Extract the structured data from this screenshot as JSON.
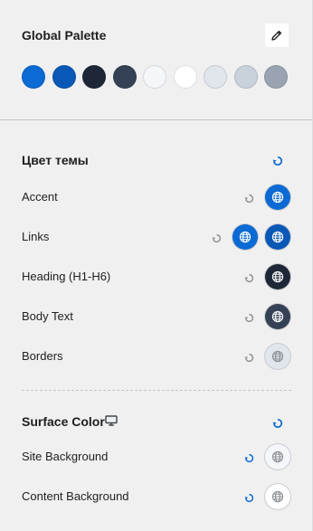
{
  "palette": {
    "title": "Global Palette",
    "colors": [
      "#0b6ad3",
      "#0a58b6",
      "#1e2737",
      "#354255",
      "#f4f6f9",
      "#ffffff",
      "#e1e5ec",
      "#c9d1da",
      "#9aa3b2"
    ]
  },
  "theme": {
    "title": "Цвет темы",
    "rows": [
      {
        "label": "Accent",
        "swatches": [
          "#0b6ad3"
        ]
      },
      {
        "label": "Links",
        "swatches": [
          "#0b6ad3",
          "#0a58b6"
        ]
      },
      {
        "label": "Heading (H1-H6)",
        "swatches": [
          "#1e2737"
        ]
      },
      {
        "label": "Body Text",
        "swatches": [
          "#354255"
        ]
      },
      {
        "label": "Borders",
        "swatches": [
          "#e1e5ec"
        ]
      }
    ]
  },
  "surface": {
    "title": "Surface Color",
    "rows": [
      {
        "label": "Site Background",
        "swatches": [
          "#f4f6f9"
        ]
      },
      {
        "label": "Content Background",
        "swatches": [
          "#ffffff"
        ]
      }
    ]
  },
  "icons": {
    "edit": "pencil-icon",
    "reset": "reset-icon",
    "globe": "globe-icon",
    "monitor": "monitor-icon"
  },
  "accent_color": "#0b6ad3"
}
